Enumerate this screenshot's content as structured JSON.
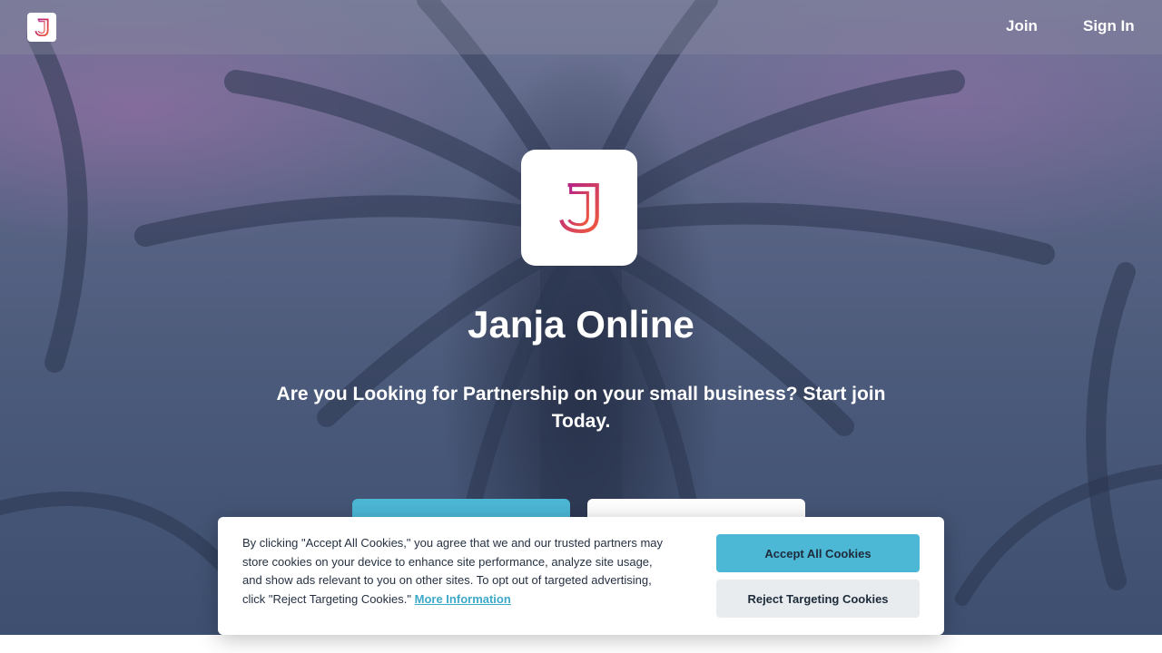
{
  "nav": {
    "join_label": "Join",
    "signin_label": "Sign In"
  },
  "hero": {
    "title": "Janja Online",
    "tagline": "Are you Looking for Partnership on your small business? Start join Today."
  },
  "cookie_banner": {
    "text": "By clicking \"Accept All Cookies,\" you agree that we and our trusted partners may store cookies on your device to enhance site performance, analyze site usage, and show ads relevant to you on other sites. To opt out of targeted advertising, click \"Reject Targeting Cookies.\"",
    "more_info_label": "More Information",
    "accept_label": "Accept All Cookies",
    "reject_label": "Reject Targeting Cookies"
  },
  "colors": {
    "accent": "#4cb8d6",
    "logo_gradient_start": "#b0208c",
    "logo_gradient_end": "#f05a3c"
  }
}
